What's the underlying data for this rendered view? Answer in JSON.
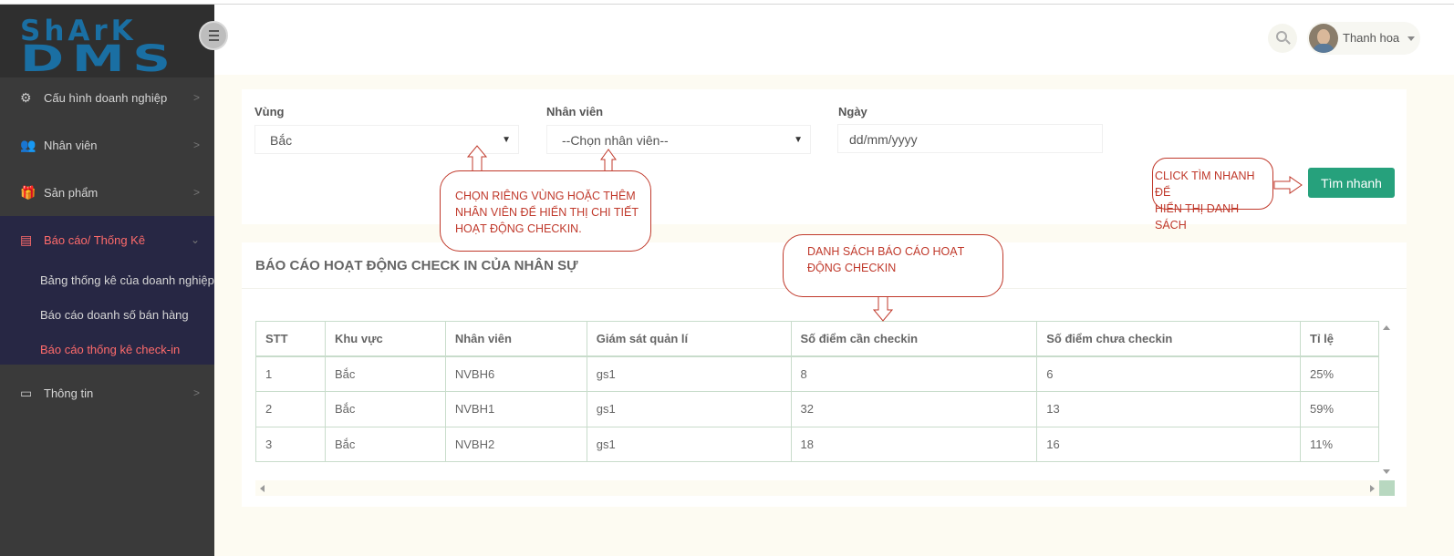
{
  "logo": {
    "line1": "ShArK",
    "line2": "DMS"
  },
  "sidebar": {
    "items": [
      {
        "label": "Cấu hình doanh nghiệp",
        "icon": "gears-icon"
      },
      {
        "label": "Nhân viên",
        "icon": "users-icon"
      },
      {
        "label": "Sản phẩm",
        "icon": "gift-icon"
      },
      {
        "label": "Báo cáo/ Thống Kê",
        "icon": "report-icon"
      },
      {
        "label": "Thông tin",
        "icon": "card-icon"
      }
    ],
    "submenu": [
      "Bảng thống kê của doanh nghiệp",
      "Báo cáo doanh số bán hàng",
      "Báo cáo thống kê check-in"
    ]
  },
  "header": {
    "user_name": "Thanh hoa"
  },
  "filters": {
    "region_label": "Vùng",
    "region_value": "Bắc",
    "employee_label": "Nhân viên",
    "employee_value": "--Chọn nhân viên--",
    "date_label": "Ngày",
    "date_placeholder": "dd/mm/yyyy",
    "quick_search_label": "Tìm nhanh"
  },
  "report": {
    "title": "BÁO CÁO HOẠT ĐỘNG CHECK IN CỦA NHÂN SỰ",
    "columns": [
      "STT",
      "Khu vực",
      "Nhân viên",
      "Giám sát quản lí",
      "Số điểm cần checkin",
      "Số điểm chưa checkin",
      "Tỉ lệ"
    ],
    "rows": [
      [
        "1",
        "Bắc",
        "NVBH6",
        "gs1",
        "8",
        "6",
        "25%"
      ],
      [
        "2",
        "Bắc",
        "NVBH1",
        "gs1",
        "32",
        "13",
        "59%"
      ],
      [
        "3",
        "Bắc",
        "NVBH2",
        "gs1",
        "18",
        "16",
        "11%"
      ]
    ]
  },
  "annotations": {
    "filter_note": [
      "CHỌN RIÊNG VÙNG HOẶC THÊM",
      "NHÂN VIÊN ĐỂ HIỂN THỊ CHI TIẾT",
      "HOẠT ĐỘNG CHECKIN."
    ],
    "list_note": [
      "DANH SÁCH BÁO CÁO HOẠT",
      "ĐỘNG CHECKIN"
    ],
    "click_note": [
      "CLICK TÌM NHANH ĐỂ",
      "HIỂN THỊ DANH SÁCH"
    ]
  },
  "colors": {
    "sidebar_bg": "#3a3a3a",
    "sidebar_active_bg": "#272744",
    "active_text": "#ff6b6b",
    "button_green": "#26a17c",
    "annotation_red": "#c0392b",
    "logo_blue": "#1a6fa3"
  }
}
